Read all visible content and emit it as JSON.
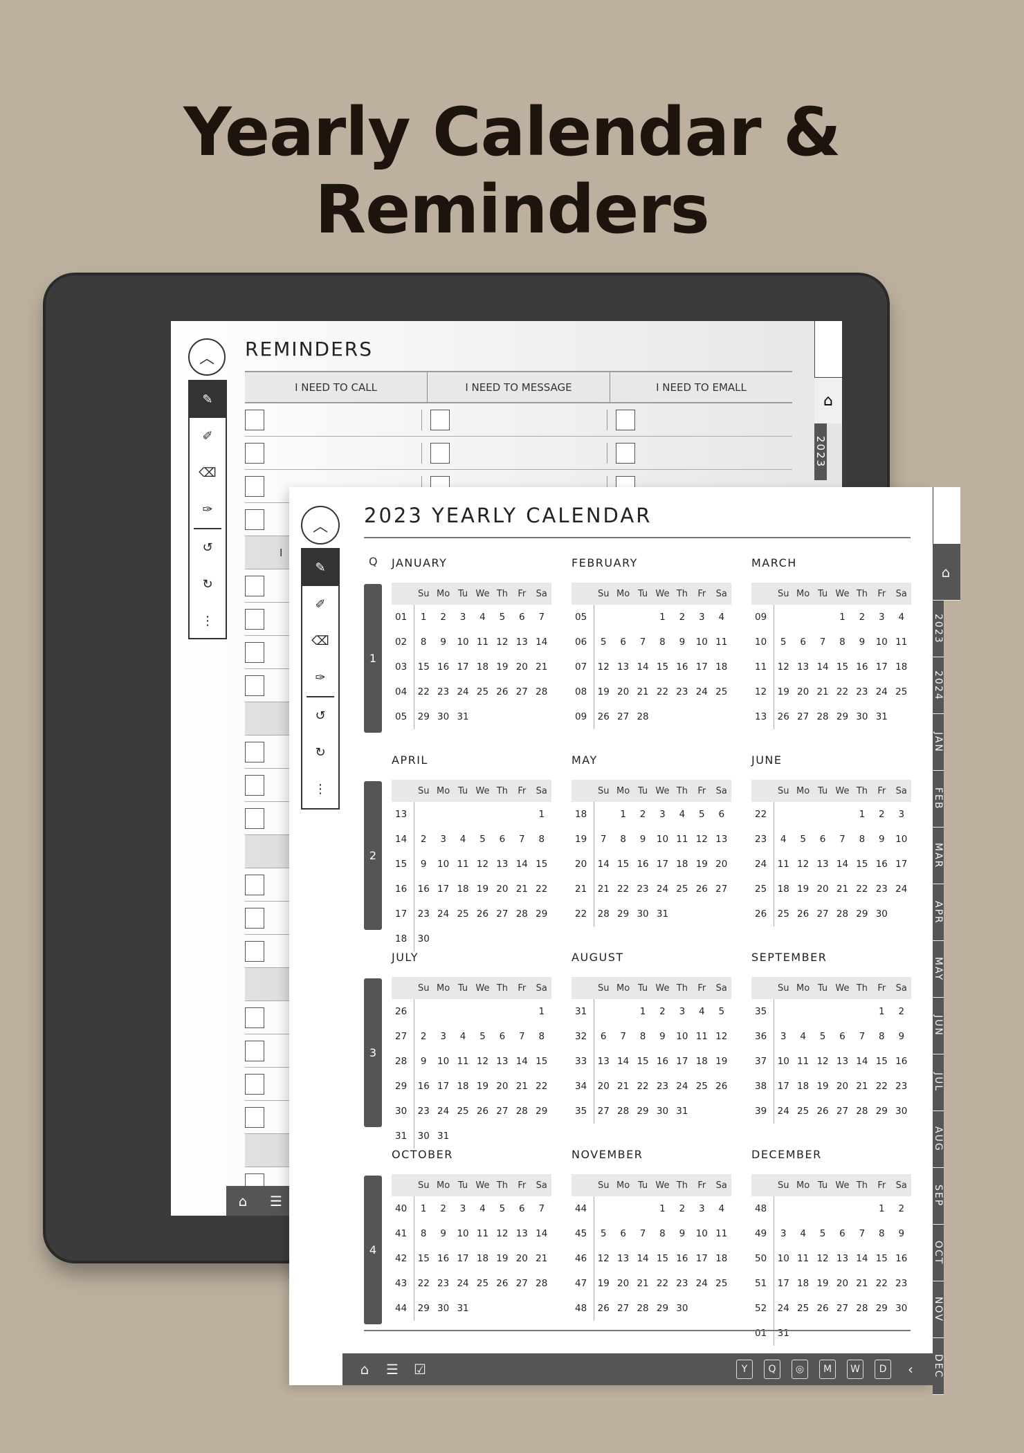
{
  "hero": {
    "title": "Yearly Calendar & Reminders"
  },
  "reminders": {
    "title": "REMINDERS",
    "columns": [
      "I NEED TO CALL",
      "I NEED TO MESSAGE",
      "I NEED TO EMALL"
    ],
    "section2_partial": "I N",
    "side_tabs": {
      "year": "2023"
    },
    "icons": {
      "up": "chevron-up-icon",
      "home": "home-icon",
      "notes": "clipboard-icon"
    }
  },
  "toolbar": {
    "up_symbol": "︿",
    "tools": [
      "pen-icon",
      "marker-icon",
      "eraser-icon",
      "lasso-icon",
      "undo-icon",
      "redo-icon",
      "more-icon"
    ],
    "symbols": [
      "✎",
      "✐",
      "⌫",
      "✑",
      "↺",
      "↻",
      "⋮"
    ]
  },
  "calendar": {
    "title": "2023 YEARLY CALENDAR",
    "q_label": "Q",
    "weekdays": [
      "Su",
      "Mo",
      "Tu",
      "We",
      "Th",
      "Fr",
      "Sa"
    ],
    "quarters": [
      {
        "q": "1",
        "months": [
          {
            "name": "JANUARY",
            "weeks": [
              [
                "01",
                [
                  "1",
                  "2",
                  "3",
                  "4",
                  "5",
                  "6",
                  "7"
                ]
              ],
              [
                "02",
                [
                  "8",
                  "9",
                  "10",
                  "11",
                  "12",
                  "13",
                  "14"
                ]
              ],
              [
                "03",
                [
                  "15",
                  "16",
                  "17",
                  "18",
                  "19",
                  "20",
                  "21"
                ]
              ],
              [
                "04",
                [
                  "22",
                  "23",
                  "24",
                  "25",
                  "26",
                  "27",
                  "28"
                ]
              ],
              [
                "05",
                [
                  "29",
                  "30",
                  "31",
                  "",
                  "",
                  "",
                  ""
                ]
              ]
            ]
          },
          {
            "name": "FEBRUARY",
            "weeks": [
              [
                "05",
                [
                  "",
                  "",
                  "",
                  "1",
                  "2",
                  "3",
                  "4"
                ]
              ],
              [
                "06",
                [
                  "5",
                  "6",
                  "7",
                  "8",
                  "9",
                  "10",
                  "11"
                ]
              ],
              [
                "07",
                [
                  "12",
                  "13",
                  "14",
                  "15",
                  "16",
                  "17",
                  "18"
                ]
              ],
              [
                "08",
                [
                  "19",
                  "20",
                  "21",
                  "22",
                  "23",
                  "24",
                  "25"
                ]
              ],
              [
                "09",
                [
                  "26",
                  "27",
                  "28",
                  "",
                  "",
                  "",
                  ""
                ]
              ]
            ]
          },
          {
            "name": "MARCH",
            "weeks": [
              [
                "09",
                [
                  "",
                  "",
                  "",
                  "1",
                  "2",
                  "3",
                  "4"
                ]
              ],
              [
                "10",
                [
                  "5",
                  "6",
                  "7",
                  "8",
                  "9",
                  "10",
                  "11"
                ]
              ],
              [
                "11",
                [
                  "12",
                  "13",
                  "14",
                  "15",
                  "16",
                  "17",
                  "18"
                ]
              ],
              [
                "12",
                [
                  "19",
                  "20",
                  "21",
                  "22",
                  "23",
                  "24",
                  "25"
                ]
              ],
              [
                "13",
                [
                  "26",
                  "27",
                  "28",
                  "29",
                  "30",
                  "31",
                  ""
                ]
              ]
            ]
          }
        ]
      },
      {
        "q": "2",
        "months": [
          {
            "name": "APRIL",
            "weeks": [
              [
                "13",
                [
                  "",
                  "",
                  "",
                  "",
                  "",
                  "",
                  "1"
                ]
              ],
              [
                "14",
                [
                  "2",
                  "3",
                  "4",
                  "5",
                  "6",
                  "7",
                  "8"
                ]
              ],
              [
                "15",
                [
                  "9",
                  "10",
                  "11",
                  "12",
                  "13",
                  "14",
                  "15"
                ]
              ],
              [
                "16",
                [
                  "16",
                  "17",
                  "18",
                  "19",
                  "20",
                  "21",
                  "22"
                ]
              ],
              [
                "17",
                [
                  "23",
                  "24",
                  "25",
                  "26",
                  "27",
                  "28",
                  "29"
                ]
              ],
              [
                "18",
                [
                  "30",
                  "",
                  "",
                  "",
                  "",
                  "",
                  ""
                ]
              ]
            ]
          },
          {
            "name": "MAY",
            "weeks": [
              [
                "18",
                [
                  "",
                  "1",
                  "2",
                  "3",
                  "4",
                  "5",
                  "6"
                ]
              ],
              [
                "19",
                [
                  "7",
                  "8",
                  "9",
                  "10",
                  "11",
                  "12",
                  "13"
                ]
              ],
              [
                "20",
                [
                  "14",
                  "15",
                  "16",
                  "17",
                  "18",
                  "19",
                  "20"
                ]
              ],
              [
                "21",
                [
                  "21",
                  "22",
                  "23",
                  "24",
                  "25",
                  "26",
                  "27"
                ]
              ],
              [
                "22",
                [
                  "28",
                  "29",
                  "30",
                  "31",
                  "",
                  "",
                  ""
                ]
              ]
            ]
          },
          {
            "name": "JUNE",
            "weeks": [
              [
                "22",
                [
                  "",
                  "",
                  "",
                  "",
                  "1",
                  "2",
                  "3"
                ]
              ],
              [
                "23",
                [
                  "4",
                  "5",
                  "6",
                  "7",
                  "8",
                  "9",
                  "10"
                ]
              ],
              [
                "24",
                [
                  "11",
                  "12",
                  "13",
                  "14",
                  "15",
                  "16",
                  "17"
                ]
              ],
              [
                "25",
                [
                  "18",
                  "19",
                  "20",
                  "21",
                  "22",
                  "23",
                  "24"
                ]
              ],
              [
                "26",
                [
                  "25",
                  "26",
                  "27",
                  "28",
                  "29",
                  "30",
                  ""
                ]
              ]
            ]
          }
        ]
      },
      {
        "q": "3",
        "months": [
          {
            "name": "JULY",
            "weeks": [
              [
                "26",
                [
                  "",
                  "",
                  "",
                  "",
                  "",
                  "",
                  "1"
                ]
              ],
              [
                "27",
                [
                  "2",
                  "3",
                  "4",
                  "5",
                  "6",
                  "7",
                  "8"
                ]
              ],
              [
                "28",
                [
                  "9",
                  "10",
                  "11",
                  "12",
                  "13",
                  "14",
                  "15"
                ]
              ],
              [
                "29",
                [
                  "16",
                  "17",
                  "18",
                  "19",
                  "20",
                  "21",
                  "22"
                ]
              ],
              [
                "30",
                [
                  "23",
                  "24",
                  "25",
                  "26",
                  "27",
                  "28",
                  "29"
                ]
              ],
              [
                "31",
                [
                  "30",
                  "31",
                  "",
                  "",
                  "",
                  "",
                  ""
                ]
              ]
            ]
          },
          {
            "name": "AUGUST",
            "weeks": [
              [
                "31",
                [
                  "",
                  "",
                  "1",
                  "2",
                  "3",
                  "4",
                  "5"
                ]
              ],
              [
                "32",
                [
                  "6",
                  "7",
                  "8",
                  "9",
                  "10",
                  "11",
                  "12"
                ]
              ],
              [
                "33",
                [
                  "13",
                  "14",
                  "15",
                  "16",
                  "17",
                  "18",
                  "19"
                ]
              ],
              [
                "34",
                [
                  "20",
                  "21",
                  "22",
                  "23",
                  "24",
                  "25",
                  "26"
                ]
              ],
              [
                "35",
                [
                  "27",
                  "28",
                  "29",
                  "30",
                  "31",
                  "",
                  ""
                ]
              ]
            ]
          },
          {
            "name": "SEPTEMBER",
            "weeks": [
              [
                "35",
                [
                  "",
                  "",
                  "",
                  "",
                  "",
                  "1",
                  "2"
                ]
              ],
              [
                "36",
                [
                  "3",
                  "4",
                  "5",
                  "6",
                  "7",
                  "8",
                  "9"
                ]
              ],
              [
                "37",
                [
                  "10",
                  "11",
                  "12",
                  "13",
                  "14",
                  "15",
                  "16"
                ]
              ],
              [
                "38",
                [
                  "17",
                  "18",
                  "19",
                  "20",
                  "21",
                  "22",
                  "23"
                ]
              ],
              [
                "39",
                [
                  "24",
                  "25",
                  "26",
                  "27",
                  "28",
                  "29",
                  "30"
                ]
              ]
            ]
          }
        ]
      },
      {
        "q": "4",
        "months": [
          {
            "name": "OCTOBER",
            "weeks": [
              [
                "40",
                [
                  "1",
                  "2",
                  "3",
                  "4",
                  "5",
                  "6",
                  "7"
                ]
              ],
              [
                "41",
                [
                  "8",
                  "9",
                  "10",
                  "11",
                  "12",
                  "13",
                  "14"
                ]
              ],
              [
                "42",
                [
                  "15",
                  "16",
                  "17",
                  "18",
                  "19",
                  "20",
                  "21"
                ]
              ],
              [
                "43",
                [
                  "22",
                  "23",
                  "24",
                  "25",
                  "26",
                  "27",
                  "28"
                ]
              ],
              [
                "44",
                [
                  "29",
                  "30",
                  "31",
                  "",
                  "",
                  "",
                  ""
                ]
              ]
            ]
          },
          {
            "name": "NOVEMBER",
            "weeks": [
              [
                "44",
                [
                  "",
                  "",
                  "",
                  "1",
                  "2",
                  "3",
                  "4"
                ]
              ],
              [
                "45",
                [
                  "5",
                  "6",
                  "7",
                  "8",
                  "9",
                  "10",
                  "11"
                ]
              ],
              [
                "46",
                [
                  "12",
                  "13",
                  "14",
                  "15",
                  "16",
                  "17",
                  "18"
                ]
              ],
              [
                "47",
                [
                  "19",
                  "20",
                  "21",
                  "22",
                  "23",
                  "24",
                  "25"
                ]
              ],
              [
                "48",
                [
                  "26",
                  "27",
                  "28",
                  "29",
                  "30",
                  "",
                  ""
                ]
              ]
            ]
          },
          {
            "name": "DECEMBER",
            "weeks": [
              [
                "48",
                [
                  "",
                  "",
                  "",
                  "",
                  "",
                  "1",
                  "2"
                ]
              ],
              [
                "49",
                [
                  "3",
                  "4",
                  "5",
                  "6",
                  "7",
                  "8",
                  "9"
                ]
              ],
              [
                "50",
                [
                  "10",
                  "11",
                  "12",
                  "13",
                  "14",
                  "15",
                  "16"
                ]
              ],
              [
                "51",
                [
                  "17",
                  "18",
                  "19",
                  "20",
                  "21",
                  "22",
                  "23"
                ]
              ],
              [
                "52",
                [
                  "24",
                  "25",
                  "26",
                  "27",
                  "28",
                  "29",
                  "30"
                ]
              ],
              [
                "01",
                [
                  "31",
                  "",
                  "",
                  "",
                  "",
                  "",
                  ""
                ]
              ]
            ]
          }
        ]
      }
    ],
    "side_tabs": [
      "2023",
      "2024",
      "JAN",
      "FEB",
      "MAR",
      "APR",
      "MAY",
      "JUN",
      "JUL",
      "AUG",
      "SEP",
      "OCT",
      "NOV",
      "DEC"
    ],
    "bottom_bar": {
      "left": [
        {
          "name": "home-icon",
          "symbol": "⌂"
        },
        {
          "name": "notes-icon",
          "symbol": "☰"
        },
        {
          "name": "tasks-icon",
          "symbol": "☑"
        }
      ],
      "right": [
        {
          "name": "year-view-icon",
          "label": "Y"
        },
        {
          "name": "quarter-view-icon",
          "label": "Q"
        },
        {
          "name": "goals-icon",
          "label": "◎"
        },
        {
          "name": "month-view-icon",
          "label": "M"
        },
        {
          "name": "week-view-icon",
          "label": "W"
        },
        {
          "name": "day-view-icon",
          "label": "D"
        }
      ],
      "back_symbol": "‹"
    }
  }
}
